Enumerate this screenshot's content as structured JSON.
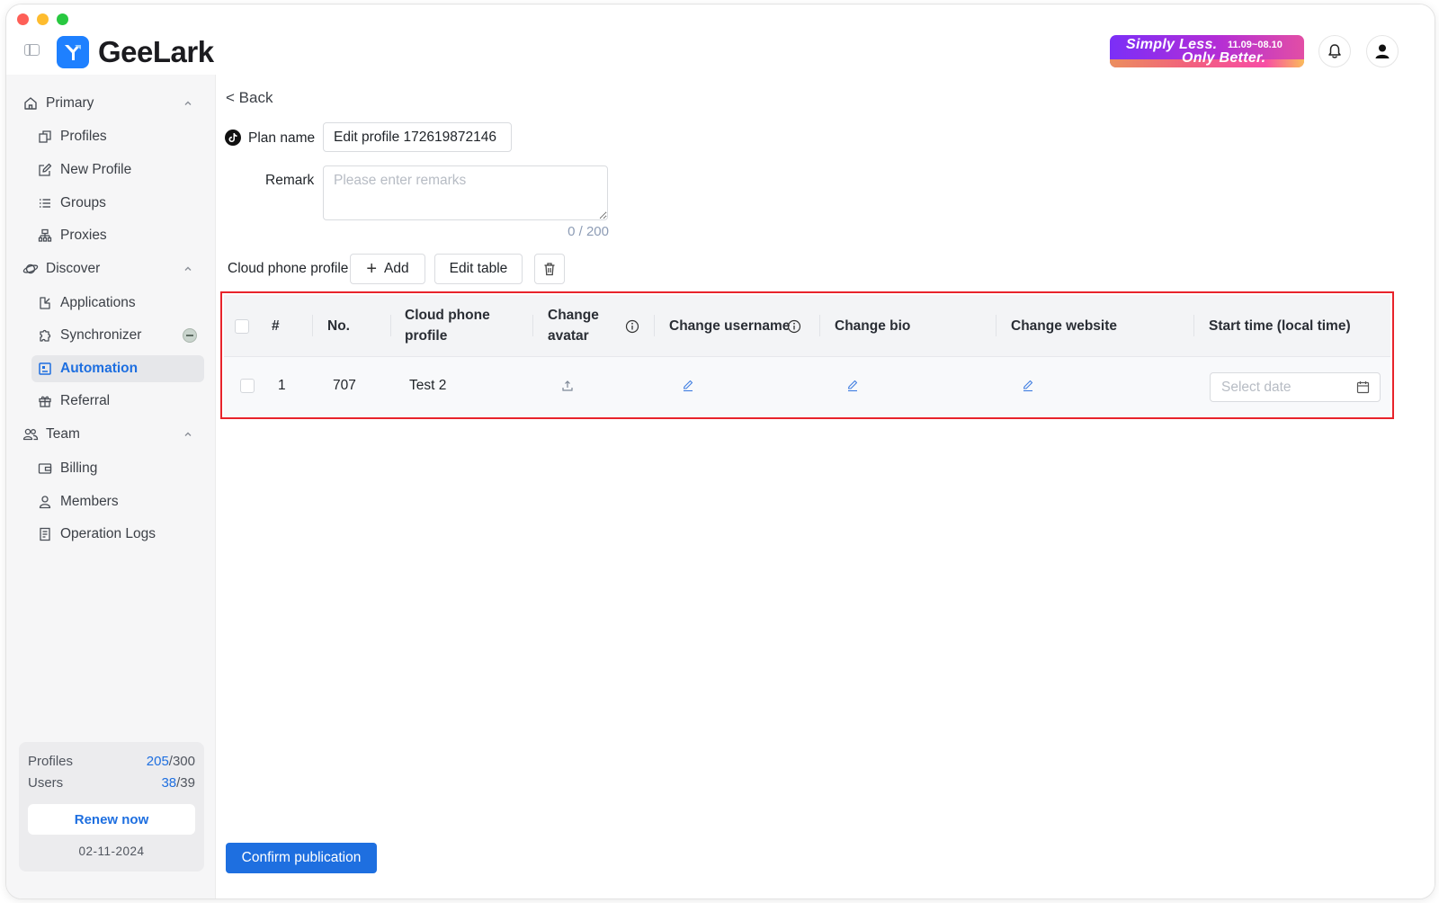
{
  "app": {
    "name": "GeeLark"
  },
  "promo": {
    "line1": "Simply Less.",
    "dates": "11.09~08.10",
    "line2": "Only Better."
  },
  "sidebar": {
    "sections": [
      {
        "label": "Primary",
        "icon": "home-icon",
        "items": [
          {
            "label": "Profiles",
            "icon": "profiles-icon"
          },
          {
            "label": "New Profile",
            "icon": "edit-icon"
          },
          {
            "label": "Groups",
            "icon": "list-icon"
          },
          {
            "label": "Proxies",
            "icon": "network-icon"
          }
        ]
      },
      {
        "label": "Discover",
        "icon": "planet-icon",
        "items": [
          {
            "label": "Applications",
            "icon": "apps-icon"
          },
          {
            "label": "Synchronizer",
            "icon": "puzzle-icon"
          },
          {
            "label": "Automation",
            "icon": "automation-icon",
            "active": true
          },
          {
            "label": "Referral",
            "icon": "gift-icon"
          }
        ]
      },
      {
        "label": "Team",
        "icon": "team-icon",
        "items": [
          {
            "label": "Billing",
            "icon": "wallet-icon"
          },
          {
            "label": "Members",
            "icon": "members-icon"
          },
          {
            "label": "Operation Logs",
            "icon": "logs-icon"
          }
        ]
      }
    ],
    "quota": {
      "profiles_label": "Profiles",
      "profiles_used": "205",
      "profiles_total": "/300",
      "users_label": "Users",
      "users_used": "38",
      "users_total": "/39",
      "renew_label": "Renew now",
      "date": "02-11-2024"
    }
  },
  "form": {
    "back_label": "< Back",
    "plan_name_label": "Plan name",
    "plan_name_value": "Edit profile 172619872146",
    "remark_label": "Remark",
    "remark_placeholder": "Please enter remarks",
    "remark_counter": "0 / 200",
    "cloud_phone_label": "Cloud phone profile",
    "add_label": "Add",
    "edit_table_label": "Edit table"
  },
  "table": {
    "headers": {
      "index": "#",
      "no": "No.",
      "cloud_phone_profile": "Cloud phone profile",
      "change_avatar": "Change avatar",
      "change_username": "Change username",
      "change_bio": "Change bio",
      "change_website": "Change website",
      "start_time": "Start time (local time)"
    },
    "rows": [
      {
        "index": "1",
        "no": "707",
        "profile": "Test 2",
        "date_placeholder": "Select date"
      }
    ]
  },
  "footer": {
    "confirm_label": "Confirm publication"
  },
  "colors": {
    "accent": "#1e6fe0",
    "highlight_border": "#e8232b",
    "logo_blue": "#1e80ff"
  }
}
